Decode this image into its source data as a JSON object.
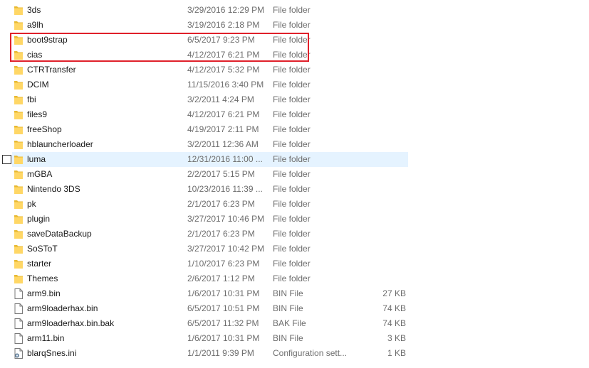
{
  "files": [
    {
      "name": "3ds",
      "date": "3/29/2016 12:29 PM",
      "type": "File folder",
      "size": "",
      "icon": "folder-icon"
    },
    {
      "name": "a9lh",
      "date": "3/19/2016 2:18 PM",
      "type": "File folder",
      "size": "",
      "icon": "folder-icon"
    },
    {
      "name": "boot9strap",
      "date": "6/5/2017 9:23 PM",
      "type": "File folder",
      "size": "",
      "icon": "folder-icon"
    },
    {
      "name": "cias",
      "date": "4/12/2017 6:21 PM",
      "type": "File folder",
      "size": "",
      "icon": "folder-icon"
    },
    {
      "name": "CTRTransfer",
      "date": "4/12/2017 5:32 PM",
      "type": "File folder",
      "size": "",
      "icon": "folder-icon"
    },
    {
      "name": "DCIM",
      "date": "11/15/2016 3:40 PM",
      "type": "File folder",
      "size": "",
      "icon": "folder-icon"
    },
    {
      "name": "fbi",
      "date": "3/2/2011 4:24 PM",
      "type": "File folder",
      "size": "",
      "icon": "folder-icon"
    },
    {
      "name": "files9",
      "date": "4/12/2017 6:21 PM",
      "type": "File folder",
      "size": "",
      "icon": "folder-icon"
    },
    {
      "name": "freeShop",
      "date": "4/19/2017 2:11 PM",
      "type": "File folder",
      "size": "",
      "icon": "folder-icon"
    },
    {
      "name": "hblauncherloader",
      "date": "3/2/2011 12:36 AM",
      "type": "File folder",
      "size": "",
      "icon": "folder-icon"
    },
    {
      "name": "luma",
      "date": "12/31/2016 11:00 ...",
      "type": "File folder",
      "size": "",
      "icon": "folder-icon"
    },
    {
      "name": "mGBA",
      "date": "2/2/2017 5:15 PM",
      "type": "File folder",
      "size": "",
      "icon": "folder-icon"
    },
    {
      "name": "Nintendo 3DS",
      "date": "10/23/2016 11:39 ...",
      "type": "File folder",
      "size": "",
      "icon": "folder-icon"
    },
    {
      "name": "pk",
      "date": "2/1/2017 6:23 PM",
      "type": "File folder",
      "size": "",
      "icon": "folder-icon"
    },
    {
      "name": "plugin",
      "date": "3/27/2017 10:46 PM",
      "type": "File folder",
      "size": "",
      "icon": "folder-icon"
    },
    {
      "name": "saveDataBackup",
      "date": "2/1/2017 6:23 PM",
      "type": "File folder",
      "size": "",
      "icon": "folder-icon"
    },
    {
      "name": "SoSToT",
      "date": "3/27/2017 10:42 PM",
      "type": "File folder",
      "size": "",
      "icon": "folder-icon"
    },
    {
      "name": "starter",
      "date": "1/10/2017 6:23 PM",
      "type": "File folder",
      "size": "",
      "icon": "folder-icon"
    },
    {
      "name": "Themes",
      "date": "2/6/2017 1:12 PM",
      "type": "File folder",
      "size": "",
      "icon": "folder-icon"
    },
    {
      "name": "arm9.bin",
      "date": "1/6/2017 10:31 PM",
      "type": "BIN File",
      "size": "27 KB",
      "icon": "file-icon"
    },
    {
      "name": "arm9loaderhax.bin",
      "date": "6/5/2017 10:51 PM",
      "type": "BIN File",
      "size": "74 KB",
      "icon": "file-icon"
    },
    {
      "name": "arm9loaderhax.bin.bak",
      "date": "6/5/2017 11:32 PM",
      "type": "BAK File",
      "size": "74 KB",
      "icon": "file-icon"
    },
    {
      "name": "arm11.bin",
      "date": "1/6/2017 10:31 PM",
      "type": "BIN File",
      "size": "3 KB",
      "icon": "file-icon"
    },
    {
      "name": "blarqSnes.ini",
      "date": "1/1/2011 9:39 PM",
      "type": "Configuration sett...",
      "size": "1 KB",
      "icon": "settings-file-icon"
    }
  ],
  "hovered_row": "luma",
  "highlighted_rows": [
    "boot9strap",
    "cias"
  ],
  "colors": {
    "folder": "#ffd766",
    "hover": "#e5f3ff",
    "highlight_border": "#e0202a",
    "meta_text": "#6d6d6d"
  }
}
